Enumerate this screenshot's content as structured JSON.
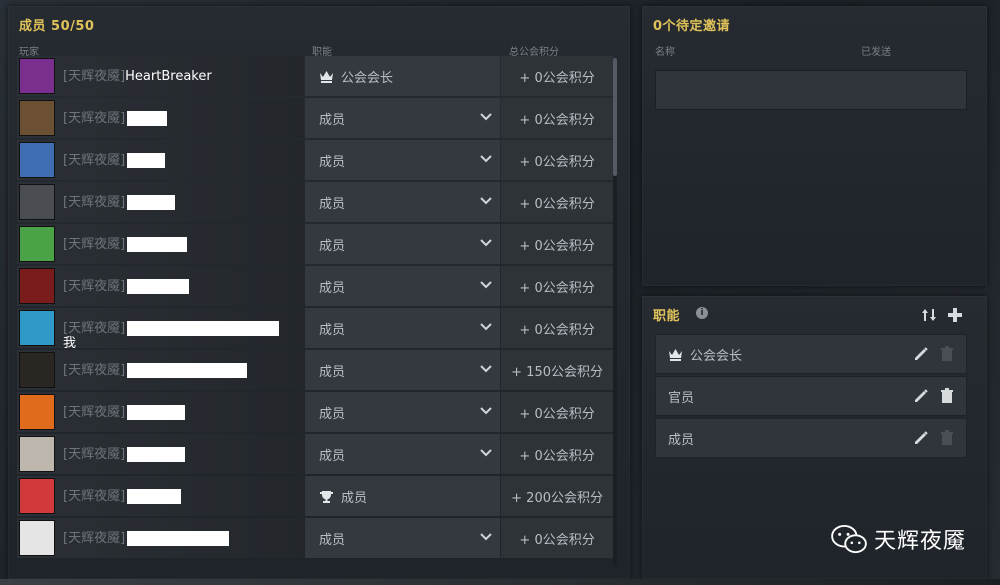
{
  "members": {
    "title": "成员 50/50",
    "columns": {
      "player": "玩家",
      "role": "职能",
      "points": "总公会积分"
    },
    "rows": [
      {
        "tag": "[天辉夜魇]",
        "name": "HeartBreaker",
        "redact_width": 0,
        "role": "公会会长",
        "role_icon": "crown",
        "dropdown": false,
        "points": "+ 0公会积分",
        "avatar_color": "#7a2f8f",
        "avatar_icon": "purple-armor"
      },
      {
        "tag": "[天辉夜魇]",
        "name": "",
        "redact_width": 40,
        "role": "成员",
        "role_icon": "",
        "dropdown": true,
        "points": "+ 0公会积分",
        "avatar_color": "#6b5033",
        "avatar_icon": "joker-face"
      },
      {
        "tag": "[天辉夜魇]",
        "name": "",
        "redact_width": 38,
        "role": "成员",
        "role_icon": "",
        "dropdown": true,
        "points": "+ 0公会积分",
        "avatar_color": "#3f6fb2",
        "avatar_icon": "colorful-creature"
      },
      {
        "tag": "[天辉夜魇]",
        "name": "",
        "redact_width": 48,
        "role": "成员",
        "role_icon": "",
        "dropdown": true,
        "points": "+ 0公会积分",
        "avatar_color": "#4a4d52",
        "avatar_icon": "wolf-sigil"
      },
      {
        "tag": "[天辉夜魇]",
        "name": "",
        "redact_width": 60,
        "role": "成员",
        "role_icon": "",
        "dropdown": true,
        "points": "+ 0公会积分",
        "avatar_color": "#4aa347",
        "avatar_icon": "cartoon-girl"
      },
      {
        "tag": "[天辉夜魇]",
        "name": "",
        "redact_width": 62,
        "role": "成员",
        "role_icon": "",
        "dropdown": true,
        "points": "+ 0公会积分",
        "avatar_color": "#7a1c1c",
        "avatar_icon": "anime-girl"
      },
      {
        "tag": "[天辉夜魇]",
        "name": "",
        "redact_width": 152,
        "sub_name": "我",
        "role": "成员",
        "role_icon": "",
        "dropdown": true,
        "points": "+ 0公会积分",
        "avatar_color": "#2f9ac7",
        "avatar_icon": "blond-face"
      },
      {
        "tag": "[天辉夜魇]",
        "name": "",
        "redact_width": 120,
        "role": "成员",
        "role_icon": "",
        "dropdown": true,
        "points": "+ 150公会积分",
        "avatar_color": "#2a2622",
        "avatar_icon": "emblem"
      },
      {
        "tag": "[天辉夜魇]",
        "name": "",
        "redact_width": 58,
        "role": "成员",
        "role_icon": "",
        "dropdown": true,
        "points": "+ 0公会积分",
        "avatar_color": "#e06b1c",
        "avatar_icon": "orange-gem"
      },
      {
        "tag": "[天辉夜魇]",
        "name": "",
        "redact_width": 58,
        "role": "成员",
        "role_icon": "",
        "dropdown": true,
        "points": "+ 0公会积分",
        "avatar_color": "#bdb7ad",
        "avatar_icon": "sketch-portrait"
      },
      {
        "tag": "[天辉夜魇]",
        "name": "",
        "redact_width": 54,
        "role": "成员",
        "role_icon": "trophy",
        "dropdown": false,
        "points": "+ 200公会积分",
        "avatar_color": "#d13a3a",
        "avatar_icon": "panda-mask"
      },
      {
        "tag": "[天辉夜魇]",
        "name": "",
        "redact_width": 102,
        "role": "成员",
        "role_icon": "",
        "dropdown": true,
        "points": "+ 0公会积分",
        "avatar_color": "#e5e5e5",
        "avatar_icon": "sketch-girl"
      }
    ]
  },
  "invites": {
    "title": "0个待定邀请",
    "columns": {
      "name": "名称",
      "sent": "已发送"
    }
  },
  "roles": {
    "title": "职能",
    "items": [
      {
        "label": "公会会长",
        "icon": "crown",
        "delete_enabled": false
      },
      {
        "label": "官员",
        "icon": "",
        "delete_enabled": true
      },
      {
        "label": "成员",
        "icon": "",
        "delete_enabled": false
      }
    ]
  },
  "watermark": {
    "text": "天辉夜魇",
    "icon": "wechat-icon"
  },
  "colors": {
    "accent": "#e0c25a",
    "panel": "#262b31",
    "cell": "#34393f"
  }
}
